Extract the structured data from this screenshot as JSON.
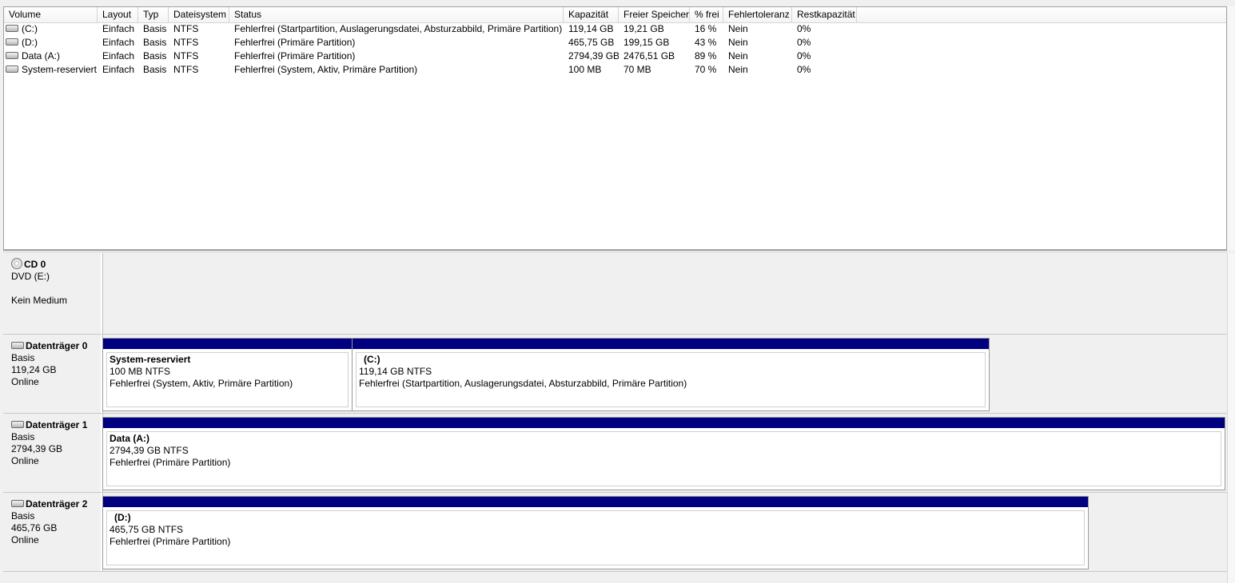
{
  "volume_list": {
    "columns": [
      "Volume",
      "Layout",
      "Typ",
      "Dateisystem",
      "Status",
      "Kapazität",
      "Freier Speicher",
      "% frei",
      "Fehlertoleranz",
      "Restkapazität"
    ],
    "rows": [
      {
        "volume": "(C:)",
        "layout": "Einfach",
        "typ": "Basis",
        "dateisystem": "NTFS",
        "status": "Fehlerfrei (Startpartition, Auslagerungsdatei, Absturzabbild, Primäre Partition)",
        "kapazitaet": "119,14 GB",
        "frei": "19,21 GB",
        "prozent": "16 %",
        "fehlertoleranz": "Nein",
        "rest": "0%"
      },
      {
        "volume": "(D:)",
        "layout": "Einfach",
        "typ": "Basis",
        "dateisystem": "NTFS",
        "status": "Fehlerfrei (Primäre Partition)",
        "kapazitaet": "465,75 GB",
        "frei": "199,15 GB",
        "prozent": "43 %",
        "fehlertoleranz": "Nein",
        "rest": "0%"
      },
      {
        "volume": "Data (A:)",
        "layout": "Einfach",
        "typ": "Basis",
        "dateisystem": "NTFS",
        "status": "Fehlerfrei (Primäre Partition)",
        "kapazitaet": "2794,39 GB",
        "frei": "2476,51 GB",
        "prozent": "89 %",
        "fehlertoleranz": "Nein",
        "rest": "0%"
      },
      {
        "volume": "System-reserviert",
        "layout": "Einfach",
        "typ": "Basis",
        "dateisystem": "NTFS",
        "status": "Fehlerfrei (System, Aktiv, Primäre Partition)",
        "kapazitaet": "100 MB",
        "frei": "70 MB",
        "prozent": "70 %",
        "fehlertoleranz": "Nein",
        "rest": "0%"
      }
    ]
  },
  "disks": [
    {
      "title": "CD 0",
      "line1": "DVD (E:)",
      "line2": "",
      "line3": "Kein Medium",
      "icon": "cd-icon",
      "partitions": []
    },
    {
      "title": "Datenträger 0",
      "line1": "Basis",
      "line2": "119,24 GB",
      "line3": "Online",
      "icon": "disk-icon",
      "partitions": [
        {
          "title": "System-reserviert",
          "size": "100 MB NTFS",
          "status": "Fehlerfrei (System, Aktiv, Primäre Partition)"
        },
        {
          "title": "(C:)",
          "size": "119,14 GB NTFS",
          "status": "Fehlerfrei (Startpartition, Auslagerungsdatei, Absturzabbild, Primäre Partition)"
        }
      ]
    },
    {
      "title": "Datenträger 1",
      "line1": "Basis",
      "line2": "2794,39 GB",
      "line3": "Online",
      "icon": "disk-icon",
      "partitions": [
        {
          "title": "Data  (A:)",
          "size": "2794,39 GB NTFS",
          "status": "Fehlerfrei (Primäre Partition)"
        }
      ]
    },
    {
      "title": "Datenträger 2",
      "line1": "Basis",
      "line2": "465,76 GB",
      "line3": "Online",
      "icon": "disk-icon",
      "partitions": [
        {
          "title": "(D:)",
          "size": "465,75 GB NTFS",
          "status": "Fehlerfrei (Primäre Partition)"
        }
      ]
    }
  ],
  "colors": {
    "partition_bar": "#000080",
    "background": "#f0f0f0"
  }
}
